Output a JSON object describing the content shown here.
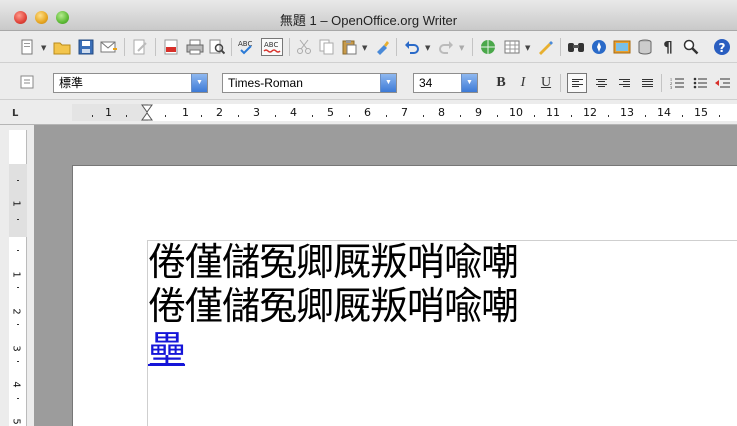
{
  "window": {
    "title": "無題 1 – OpenOffice.org Writer"
  },
  "toolbar_standard": {
    "icons": [
      "new-icon",
      "open-icon",
      "save-icon",
      "email-icon",
      "edit-file-icon",
      "export-pdf-icon",
      "print-icon",
      "page-preview-icon",
      "spellcheck-icon",
      "autospellcheck-icon",
      "cut-icon",
      "copy-icon",
      "paste-icon",
      "format-paintbrush-icon",
      "undo-icon",
      "redo-icon",
      "hyperlink-icon",
      "table-icon",
      "show-draw-functions-icon",
      "find-replace-icon",
      "navigator-icon",
      "gallery-icon",
      "data-sources-icon",
      "formatting-marks-icon",
      "zoom-icon",
      "help-icon"
    ]
  },
  "toolbar_format": {
    "paragraph_style": "標準",
    "font_name": "Times-Roman",
    "font_size": "34",
    "bold_label": "B",
    "italic_label": "I",
    "underline_label": "U"
  },
  "ruler": {
    "numbers": [
      "1",
      "1",
      "2",
      "3",
      "4",
      "5",
      "6",
      "7",
      "8",
      "9",
      "10",
      "11",
      "12",
      "13",
      "14",
      "15"
    ],
    "vertical_numbers": [
      "1",
      "1",
      "2",
      "3",
      "4",
      "5"
    ]
  },
  "document": {
    "line1": "倦僅儲冤卿厩叛哨喩嘲",
    "line2": "倦僅儲冤卿厩叛哨喩嘲",
    "line3_link": "壘"
  }
}
